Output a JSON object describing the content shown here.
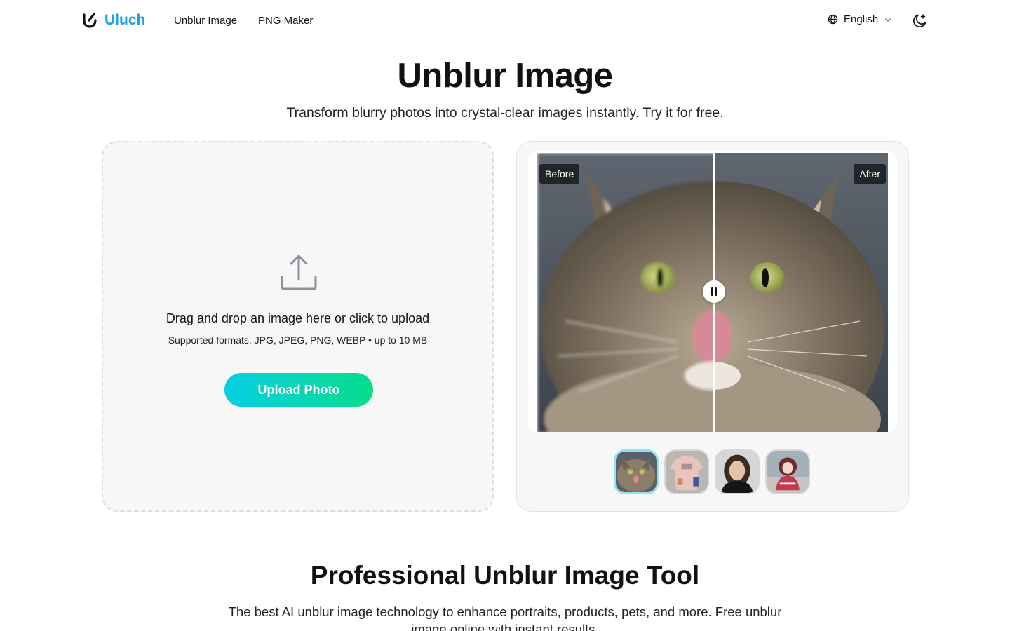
{
  "brand": {
    "name": "Uluch",
    "logo_icon": "u-logo-icon",
    "accent": "#1ca0e6"
  },
  "nav": {
    "items": [
      {
        "label": "Unblur Image"
      },
      {
        "label": "PNG Maker"
      }
    ]
  },
  "language": {
    "selected": "English",
    "icon": "globe-icon"
  },
  "theme_toggle": {
    "icon": "moon-sparkle-icon"
  },
  "hero": {
    "title": "Unblur Image",
    "subtitle": "Transform blurry photos into crystal-clear images instantly. Try it for free."
  },
  "upload": {
    "icon": "upload-icon",
    "drop_text": "Drag and drop an image here or click to upload",
    "formats_text": "Supported formats: JPG, JPEG, PNG, WEBP • up to 10 MB",
    "button_label": "Upload Photo",
    "button_gradient": [
      "#06cfe4",
      "#08dd8a"
    ]
  },
  "compare": {
    "before_label": "Before",
    "after_label": "After",
    "samples": [
      {
        "name": "cat",
        "active": true
      },
      {
        "name": "t-shirt"
      },
      {
        "name": "portrait"
      },
      {
        "name": "doll"
      }
    ]
  },
  "section": {
    "title": "Professional Unblur Image Tool",
    "text": "The best AI unblur image technology to enhance portraits, products, pets, and more. Free unblur image online with instant results."
  }
}
